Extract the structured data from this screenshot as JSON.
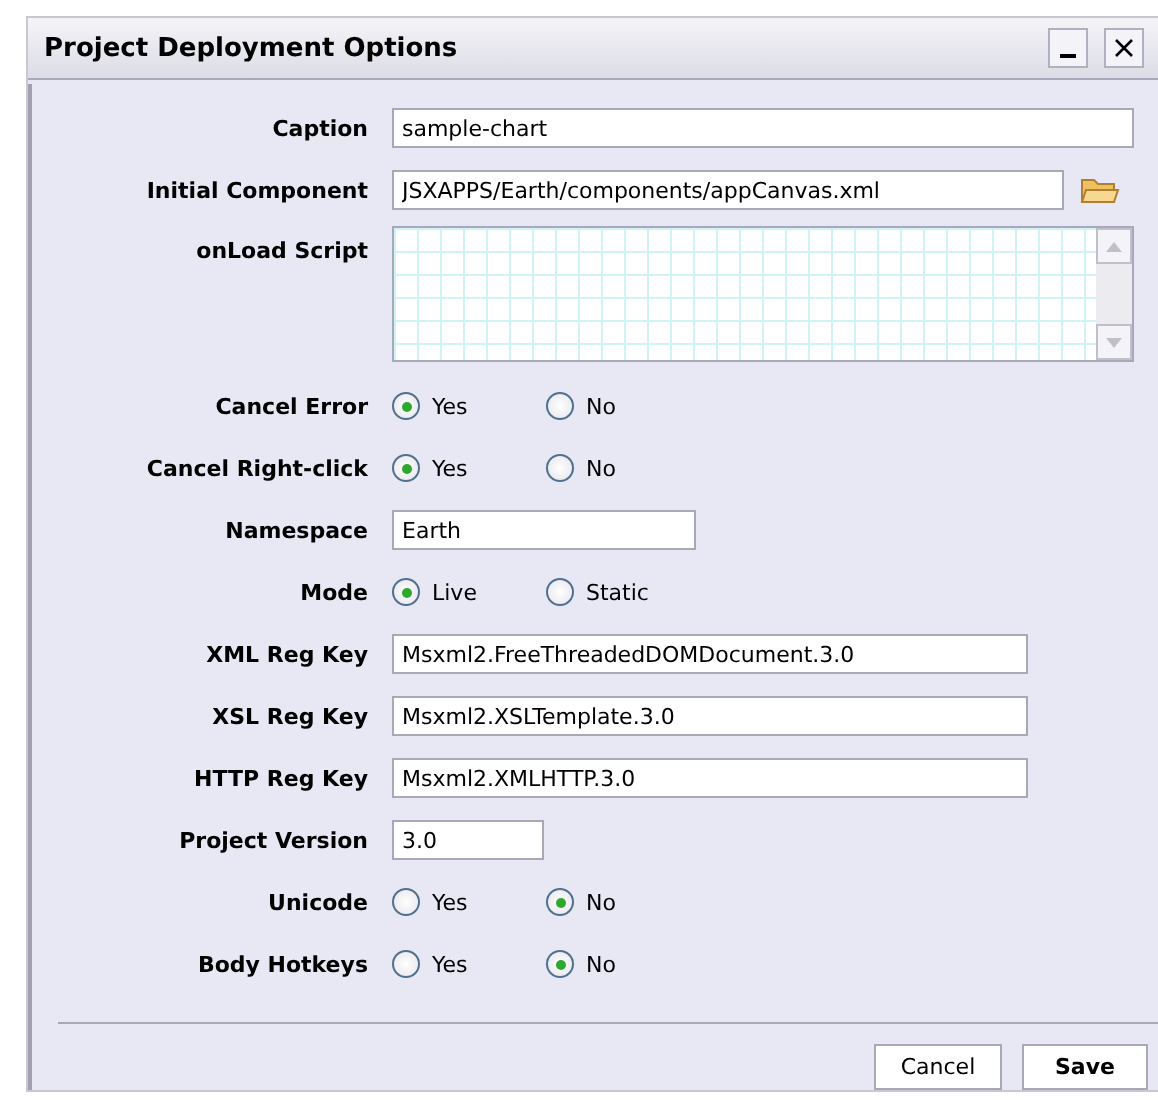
{
  "window": {
    "title": "Project Deployment Options"
  },
  "fields": [
    {
      "kind": "text",
      "label": "Caption",
      "value": "sample-chart"
    },
    {
      "kind": "file",
      "label": "Initial Component",
      "value": "JSXAPPS/Earth/components/appCanvas.xml"
    },
    {
      "kind": "textarea",
      "label": "onLoad Script"
    },
    {
      "kind": "radio",
      "label": "Cancel Error",
      "options": [
        {
          "label": "Yes",
          "selected": true
        },
        {
          "label": "No",
          "selected": false
        }
      ]
    },
    {
      "kind": "radio",
      "label": "Cancel Right-click",
      "options": [
        {
          "label": "Yes",
          "selected": true
        },
        {
          "label": "No",
          "selected": false
        }
      ]
    },
    {
      "kind": "text",
      "label": "Namespace",
      "value": "Earth"
    },
    {
      "kind": "radio",
      "label": "Mode",
      "options": [
        {
          "label": "Live",
          "selected": true
        },
        {
          "label": "Static",
          "selected": false
        }
      ]
    },
    {
      "kind": "text",
      "label": "XML Reg Key",
      "value": "Msxml2.FreeThreadedDOMDocument.3.0"
    },
    {
      "kind": "text",
      "label": "XSL Reg Key",
      "value": "Msxml2.XSLTemplate.3.0"
    },
    {
      "kind": "text",
      "label": "HTTP Reg Key",
      "value": "Msxml2.XMLHTTP.3.0"
    },
    {
      "kind": "text",
      "label": "Project Version",
      "value": "3.0"
    },
    {
      "kind": "radio",
      "label": "Unicode",
      "options": [
        {
          "label": "Yes",
          "selected": false
        },
        {
          "label": "No",
          "selected": true
        }
      ]
    },
    {
      "kind": "radio",
      "label": "Body Hotkeys",
      "options": [
        {
          "label": "Yes",
          "selected": false
        },
        {
          "label": "No",
          "selected": true
        }
      ]
    }
  ],
  "buttons": [
    {
      "label": "Cancel",
      "kind": "secondary"
    },
    {
      "label": "Save",
      "kind": "primary"
    }
  ]
}
